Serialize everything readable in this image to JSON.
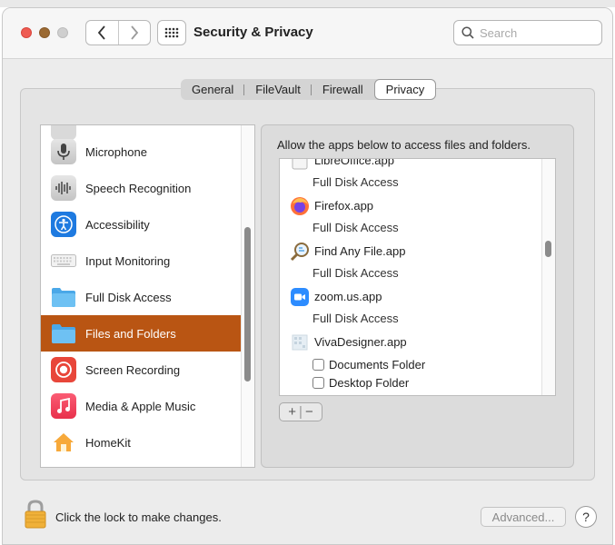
{
  "window": {
    "title": "Security & Privacy"
  },
  "search": {
    "placeholder": "Search"
  },
  "tabs": [
    {
      "label": "General"
    },
    {
      "label": "FileVault"
    },
    {
      "label": "Firewall"
    },
    {
      "label": "Privacy"
    }
  ],
  "active_tab": "Privacy",
  "categories": [
    {
      "label": "Microphone",
      "icon": "microphone-icon"
    },
    {
      "label": "Speech Recognition",
      "icon": "waveform-icon"
    },
    {
      "label": "Accessibility",
      "icon": "accessibility-icon"
    },
    {
      "label": "Input Monitoring",
      "icon": "keyboard-icon"
    },
    {
      "label": "Full Disk Access",
      "icon": "folder-icon"
    },
    {
      "label": "Files and Folders",
      "icon": "folder-icon"
    },
    {
      "label": "Screen Recording",
      "icon": "screen-recording-icon"
    },
    {
      "label": "Media & Apple Music",
      "icon": "music-note-icon"
    },
    {
      "label": "HomeKit",
      "icon": "home-icon"
    }
  ],
  "selected_category": "Files and Folders",
  "panel": {
    "prompt": "Allow the apps below to access files and folders."
  },
  "apps": [
    {
      "name": "LibreOffice.app",
      "access": "Full Disk Access"
    },
    {
      "name": "Firefox.app",
      "access": "Full Disk Access"
    },
    {
      "name": "Find Any File.app",
      "access": "Full Disk Access"
    },
    {
      "name": "zoom.us.app",
      "access": "Full Disk Access"
    },
    {
      "name": "VivaDesigner.app",
      "folders": [
        "Documents Folder",
        "Desktop Folder"
      ]
    }
  ],
  "controls": {
    "plus": "+",
    "minus": "−"
  },
  "footer": {
    "lock_text": "Click the lock to make changes.",
    "advanced_label": "Advanced...",
    "help_label": "?"
  },
  "colors": {
    "selection": "#b95513",
    "close": "#ee5b52"
  }
}
